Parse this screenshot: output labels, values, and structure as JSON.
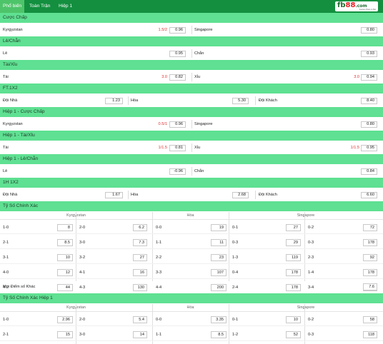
{
  "nav": {
    "tabs": [
      {
        "label": "Phổ biến",
        "active": true
      },
      {
        "label": "Toàn Trận",
        "active": false
      },
      {
        "label": "Hiệp 1",
        "active": false
      }
    ],
    "logo": {
      "fb": "fb",
      "num": "88",
      "com": ".com",
      "tagline": "Fastest Place to Bet"
    }
  },
  "markets": [
    {
      "title": "Cược Chấp",
      "row": {
        "home_label": "Kyrgyzstan",
        "home_hcp": "1.5/2",
        "home_odds": "0.96",
        "away_label": "Singapore",
        "away_hcp": "",
        "away_odds": "0.80"
      }
    },
    {
      "title": "Lẻ/Chẵn",
      "row": {
        "home_label": "Lẻ",
        "home_hcp": "",
        "home_odds": "0.95",
        "away_label": "Chẵn",
        "away_hcp": "",
        "away_odds": "0.93"
      }
    },
    {
      "title": "Tài/Xỉu",
      "row": {
        "home_label": "Tài",
        "home_hcp": "3.0",
        "home_odds": "0.82",
        "away_label": "Xỉu",
        "away_hcp": "3.0",
        "away_odds": "0.94"
      }
    },
    {
      "title": "FT.1X2",
      "row3": {
        "a_label": "Đội Nhà",
        "a_odds": "1.23",
        "b_label": "Hòa",
        "b_odds": "5.30",
        "c_label": "Đội Khách",
        "c_odds": "8.40"
      }
    },
    {
      "title": "Hiệp 1 - Cược Chấp",
      "row": {
        "home_label": "Kyrgyzstan",
        "home_hcp": "0.5/1",
        "home_odds": "0.96",
        "away_label": "Singapore",
        "away_hcp": "",
        "away_odds": "0.80"
      }
    },
    {
      "title": "Hiệp 1 - Tài/Xỉu",
      "row": {
        "home_label": "Tài",
        "home_hcp": "1/1.5",
        "home_odds": "0.81",
        "away_label": "Xỉu",
        "away_hcp": "1/1.5",
        "away_odds": "0.95"
      }
    },
    {
      "title": "Hiệp 1 - Lẻ/Chẵn",
      "row": {
        "home_label": "Lẻ",
        "home_hcp": "",
        "home_odds": "-0.96",
        "away_label": "Chẵn",
        "away_hcp": "",
        "away_odds": "0.84"
      }
    },
    {
      "title": "1H 1X2",
      "row3": {
        "a_label": "Đội Nhà",
        "a_odds": "1.67",
        "b_label": "Hòa",
        "b_odds": "2.68",
        "c_label": "Đội Khách",
        "c_odds": "6.60"
      }
    }
  ],
  "correct_score": {
    "title": "Tỷ Số Chính Xác",
    "headers": [
      "Kyrgyzstan",
      "Hòa",
      "Singapore"
    ],
    "rows": [
      [
        [
          "1-0",
          "8"
        ],
        [
          "2-0",
          "6.2"
        ],
        [
          "0-0",
          "19"
        ],
        [
          "0-1",
          "27"
        ],
        [
          "0-2",
          "72"
        ]
      ],
      [
        [
          "2-1",
          "8.5"
        ],
        [
          "3-0",
          "7.3"
        ],
        [
          "1-1",
          "11"
        ],
        [
          "0-3",
          "29"
        ],
        [
          "0-3",
          "178"
        ]
      ],
      [
        [
          "3-1",
          "10"
        ],
        [
          "3-2",
          "27"
        ],
        [
          "2-2",
          "23"
        ],
        [
          "1-3",
          "119"
        ],
        [
          "2-3",
          "92"
        ]
      ],
      [
        [
          "4-0",
          "12"
        ],
        [
          "4-1",
          "16"
        ],
        [
          "3-3",
          "107"
        ],
        [
          "0-4",
          "178"
        ],
        [
          "1-4",
          "178"
        ]
      ],
      [
        [
          "4-2",
          "44"
        ],
        [
          "4-3",
          "130"
        ],
        [
          "4-4",
          "200"
        ],
        [
          "2-4",
          "178"
        ],
        [
          "3-4",
          "178"
        ]
      ]
    ],
    "other_label": "Mọi Điểm số Khác",
    "other_odds": "7.6"
  },
  "correct_score_h1": {
    "title": "Tỷ Số Chính Xác Hiệp 1",
    "headers": [
      "Kyrgyzstan",
      "Hòa",
      "Singapore"
    ],
    "rows": [
      [
        [
          "1-0",
          "2.96"
        ],
        [
          "2-0",
          "5.4"
        ],
        [
          "0-0",
          "3.35"
        ],
        [
          "0-1",
          "10"
        ],
        [
          "0-2",
          "58"
        ]
      ],
      [
        [
          "2-1",
          "15"
        ],
        [
          "3-0",
          "14"
        ],
        [
          "1-1",
          "8.5"
        ],
        [
          "1-2",
          "52"
        ],
        [
          "0-3",
          "118"
        ]
      ]
    ]
  }
}
